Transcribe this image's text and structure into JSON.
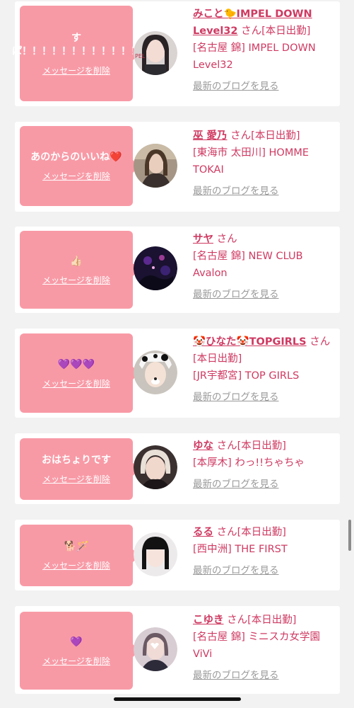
{
  "entries": [
    {
      "message": "すぱ！！！！！！！！！！！！",
      "delete_label": "メッセージを削除",
      "name": "みこと🐤IMPEL DOWN Level32",
      "san": "さん",
      "status": "[本日出勤]",
      "shop": "[名古屋 錦] IMPEL DOWN Level32",
      "blog_label": "最新のブログを見る"
    },
    {
      "message": "あのからのいいね❤️",
      "delete_label": "メッセージを削除",
      "name": "巫 愛乃",
      "san": "さん",
      "status": "[本日出勤]",
      "shop": "[東海市 太田川] HOMME TOKAI",
      "blog_label": "最新のブログを見る"
    },
    {
      "message": "👍🏻",
      "delete_label": "メッセージを削除",
      "name": "サヤ",
      "san": "さん",
      "status": "",
      "shop": "[名古屋 錦] NEW CLUB Avalon",
      "blog_label": "最新のブログを見る"
    },
    {
      "message": "💜💜💜",
      "delete_label": "メッセージを削除",
      "name": "🤡ひなた🤡TOPGIRLS",
      "san": "さん",
      "status": "[本日出勤]",
      "shop": "[JR宇都宮] TOP GIRLS",
      "blog_label": "最新のブログを見る"
    },
    {
      "message": "おはちょりです",
      "delete_label": "メッセージを削除",
      "name": "ゆな",
      "san": "さん",
      "status": "[本日出勤]",
      "shop": "[本厚木] わっ!!ちゃちゃ",
      "blog_label": "最新のブログを見る"
    },
    {
      "message": "🐕🪄",
      "delete_label": "メッセージを削除",
      "name": "るる",
      "san": "さん",
      "status": "[本日出勤]",
      "shop": "[西中洲] THE FIRST",
      "blog_label": "最新のブログを見る"
    },
    {
      "message": "💜",
      "delete_label": "メッセージを削除",
      "name": "こゆき",
      "san": "さん",
      "status": "[本日出勤]",
      "shop": "[名古屋 錦] ミニスカ女学園ViVi",
      "blog_label": "最新のブログを見る"
    }
  ],
  "colors": {
    "accent": "#cf3a62",
    "bubble": "#f89aa6",
    "background": "#f2f2f2",
    "card": "#ffffff",
    "link_gray": "#9a9a9a"
  }
}
